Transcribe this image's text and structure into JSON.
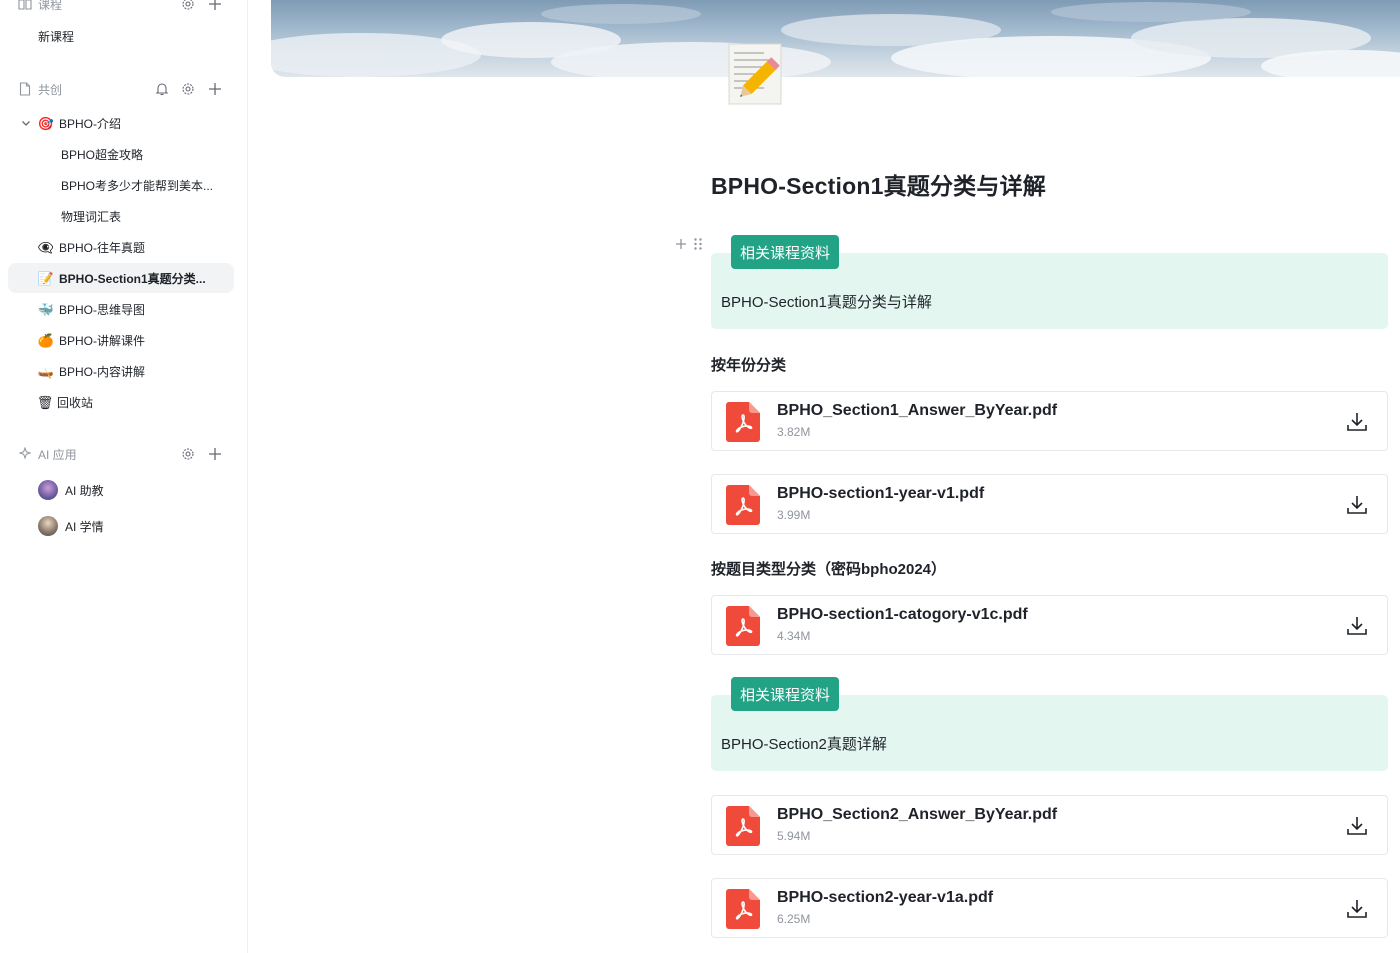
{
  "sidebar": {
    "courses": {
      "label": "课程",
      "items": [
        {
          "label": "新课程"
        }
      ]
    },
    "cocreate": {
      "label": "共创",
      "items": [
        {
          "label": "BPHO-介绍",
          "emoji": "🎯"
        },
        {
          "label": "BPHO超金攻略"
        },
        {
          "label": "BPHO考多少才能帮到美本..."
        },
        {
          "label": "物理词汇表"
        },
        {
          "label": "BPHO-往年真题",
          "emoji": "👁‍🗨"
        },
        {
          "label": "BPHO-Section1真题分类...",
          "emoji": "📝"
        },
        {
          "label": "BPHO-思维导图",
          "emoji": "🐳"
        },
        {
          "label": "BPHO-讲解课件",
          "emoji": "🍊"
        },
        {
          "label": "BPHO-内容讲解",
          "emoji": "🛶"
        },
        {
          "label": "回收站",
          "emoji": "🗑"
        }
      ]
    },
    "ai": {
      "label": "AI 应用",
      "items": [
        {
          "label": "AI 助教"
        },
        {
          "label": "AI 学情"
        }
      ]
    }
  },
  "page": {
    "title": "BPHO-Section1真题分类与详解",
    "callouts": [
      {
        "tag": "相关课程资料",
        "text": "BPHO-Section1真题分类与详解"
      },
      {
        "tag": "相关课程资料",
        "text": "BPHO-Section2真题详解"
      }
    ],
    "sections": [
      {
        "heading": "按年份分类"
      },
      {
        "heading": "按题目类型分类（密码bpho2024）"
      }
    ],
    "files": [
      {
        "name": "BPHO_Section1_Answer_ByYear.pdf",
        "size": "3.82M"
      },
      {
        "name": "BPHO-section1-year-v1.pdf",
        "size": "3.99M"
      },
      {
        "name": "BPHO-section1-catogory-v1c.pdf",
        "size": "4.34M"
      },
      {
        "name": "BPHO_Section2_Answer_ByYear.pdf",
        "size": "5.94M"
      },
      {
        "name": "BPHO-section2-year-v1a.pdf",
        "size": "6.25M"
      }
    ]
  },
  "colors": {
    "accent": "#22a386",
    "callout_bg": "#e3f7f0",
    "pdf_red": "#f04b3a",
    "active_bg": "#f2f3f5"
  }
}
